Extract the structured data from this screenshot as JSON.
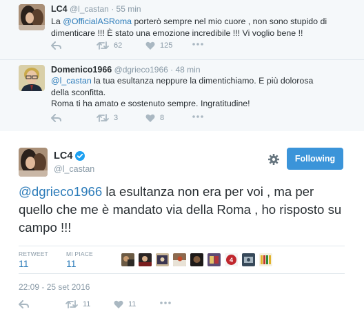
{
  "reply1": {
    "name": "LC4",
    "handle": "@l_castan",
    "separator": "·",
    "time": "55 min",
    "text_before": "La ",
    "mention": "@OfficialASRoma",
    "text_after": " porterò sempre nel mio cuore , non sono stupido di dimenticare !!! È stato una emozione incredibile !!! Vi voglio bene !!",
    "retweets": "62",
    "likes": "125"
  },
  "reply2": {
    "name": "Domenico1966",
    "handle": "@dgrieco1966",
    "separator": "·",
    "time": "48 min",
    "mention": "@l_castan",
    "text_after": " la tua esultanza neppure la dimentichiamo. E più dolorosa della sconfitta.",
    "text_line2": "Roma ti ha amato e sostenuto sempre. Ingratitudine!",
    "retweets": "3",
    "likes": "8"
  },
  "main": {
    "name": "LC4",
    "handle": "@l_castan",
    "follow_label": "Following",
    "mention": "@dgrieco1966",
    "text_after": " la esultanza non era per voi , ma per quello che me è mandato via della Roma , ho risposto su campo !!!",
    "retweet_label": "RETWEET",
    "retweet_count": "11",
    "like_label": "MI PIACE",
    "like_count": "11",
    "datetime": "22:09 - 25 set 2016",
    "action_retweets": "11",
    "action_likes": "11"
  },
  "colors": {
    "link": "#2b7bb9",
    "follow_button": "#3b94d9",
    "verified": "#1da1f2",
    "muted": "#8899a6"
  },
  "icons": [
    "reply-icon",
    "retweet-icon",
    "heart-icon",
    "more-icon",
    "verified-icon",
    "gear-icon"
  ]
}
